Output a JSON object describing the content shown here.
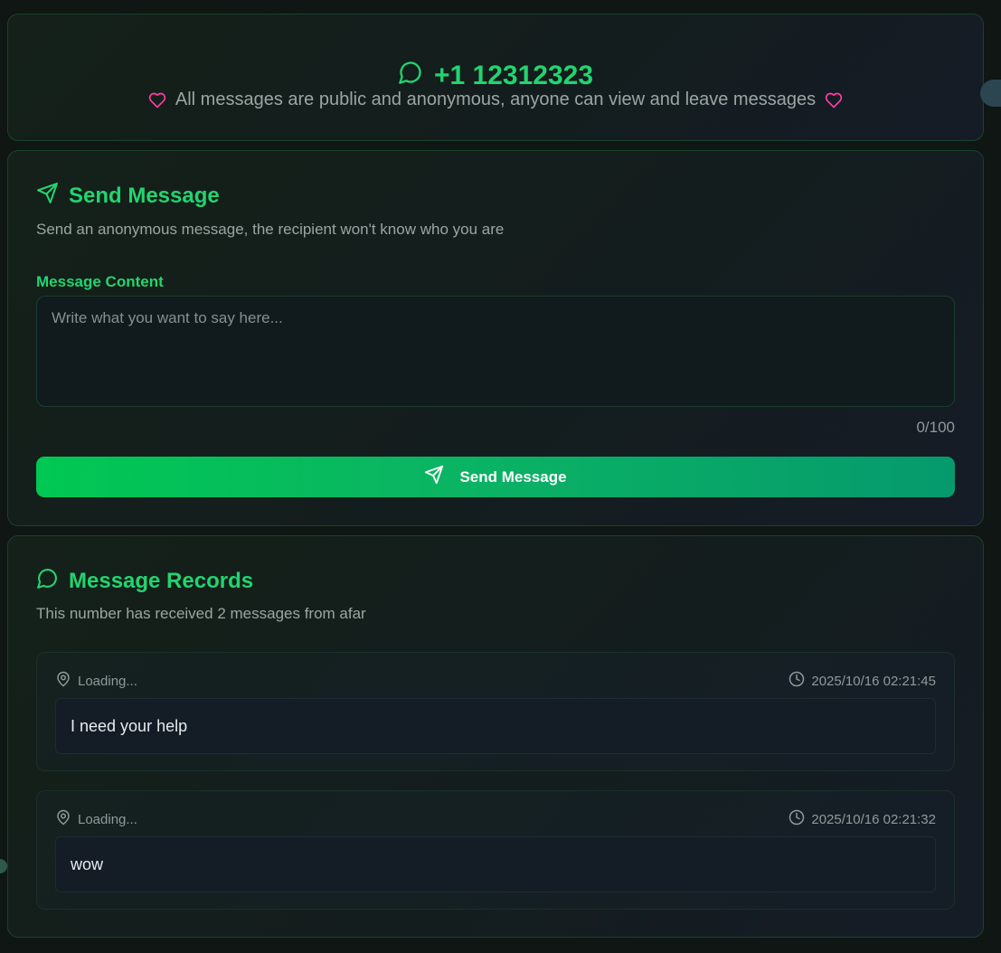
{
  "header": {
    "phone": "+1 12312323",
    "subtitle": "All messages are public and anonymous, anyone can view and leave messages"
  },
  "send": {
    "title": "Send Message",
    "description": "Send an anonymous message, the recipient won't know who you are",
    "field_label": "Message Content",
    "placeholder": "Write what you want to say here...",
    "value": "",
    "char_count": "0/100",
    "button_label": "Send Message"
  },
  "records": {
    "title": "Message Records",
    "description": "This number has received 2 messages from afar",
    "messages": [
      {
        "location": "Loading...",
        "time": "2025/10/16 02:21:45",
        "text": "I need your help"
      },
      {
        "location": "Loading...",
        "time": "2025/10/16 02:21:32",
        "text": "wow"
      }
    ]
  },
  "colors": {
    "accent": "#22d46f",
    "heart": "#ff3ea5",
    "button_start": "#00c853",
    "button_end": "#059a6d"
  },
  "icons": {
    "phone_icon": "message-circle-icon",
    "heart_icon": "heart-icon",
    "send_icon": "send-icon",
    "records_icon": "message-circle-icon",
    "location_icon": "map-pin-icon",
    "time_icon": "clock-icon"
  }
}
